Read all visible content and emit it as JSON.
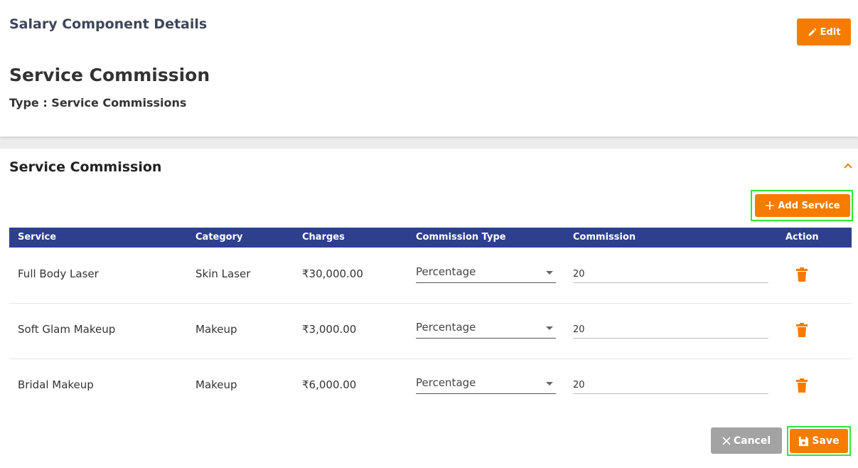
{
  "details": {
    "heading": "Salary Component Details",
    "name": "Service Commission",
    "type_line": "Type : Service Commissions",
    "edit_label": "Edit"
  },
  "section": {
    "title": "Service Commission",
    "add_label": "Add Service"
  },
  "table": {
    "columns": [
      "Service",
      "Category",
      "Charges",
      "Commission Type",
      "Commission",
      "Action"
    ],
    "rows": [
      {
        "service": "Full Body Laser",
        "category": "Skin Laser",
        "charges": "₹30,000.00",
        "commission_type": "Percentage",
        "commission": "20"
      },
      {
        "service": "Soft Glam Makeup",
        "category": "Makeup",
        "charges": "₹3,000.00",
        "commission_type": "Percentage",
        "commission": "20"
      },
      {
        "service": "Bridal Makeup",
        "category": "Makeup",
        "charges": "₹6,000.00",
        "commission_type": "Percentage",
        "commission": "20"
      }
    ]
  },
  "footer": {
    "cancel_label": "Cancel",
    "save_label": "Save"
  },
  "colors": {
    "accent": "#f57c00",
    "table_header": "#2e3f8f",
    "highlight": "#33e633",
    "cancel": "#a3a3a3"
  },
  "icons": [
    "pencil-icon",
    "chevron-up-icon",
    "plus-icon",
    "caret-down-icon",
    "trash-icon",
    "close-icon",
    "save-icon"
  ]
}
